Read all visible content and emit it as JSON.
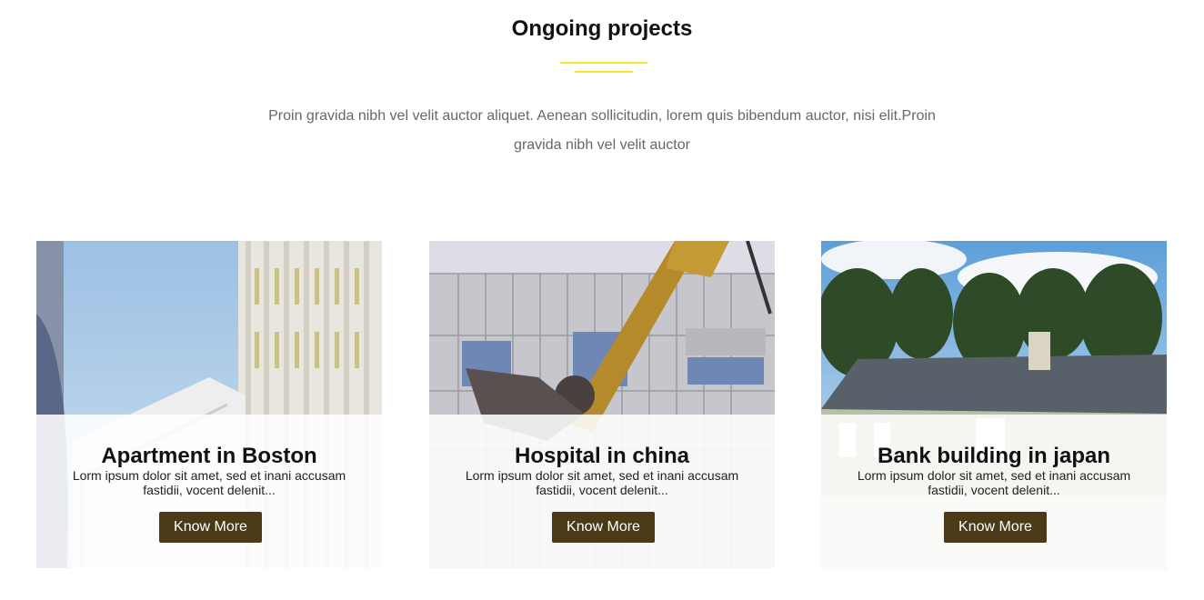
{
  "section": {
    "title": "Ongoing projects",
    "intro": "Proin gravida nibh vel velit auctor aliquet. Aenean sollicitudin, lorem quis bibendum auctor, nisi elit.Proin gravida nibh vel velit auctor"
  },
  "colors": {
    "accent_underline": "#ffe627",
    "button_bg": "#4a3a17",
    "intro_text": "#5e6a73"
  },
  "projects": [
    {
      "title": "Apartment in Boston",
      "description": "Lorm ipsum dolor sit amet, sed et inani accusam fastidii, vocent delenit...",
      "button_label": "Know More",
      "image": "apartment-building-photo"
    },
    {
      "title": "Hospital in china",
      "description": "Lorm ipsum dolor sit amet, sed et inani accusam fastidii, vocent delenit...",
      "button_label": "Know More",
      "image": "demolition-excavator-photo"
    },
    {
      "title": "Bank building in japan",
      "description": "Lorm ipsum dolor sit amet, sed et inani accusam fastidii, vocent delenit...",
      "button_label": "Know More",
      "image": "suburban-house-photo"
    }
  ]
}
